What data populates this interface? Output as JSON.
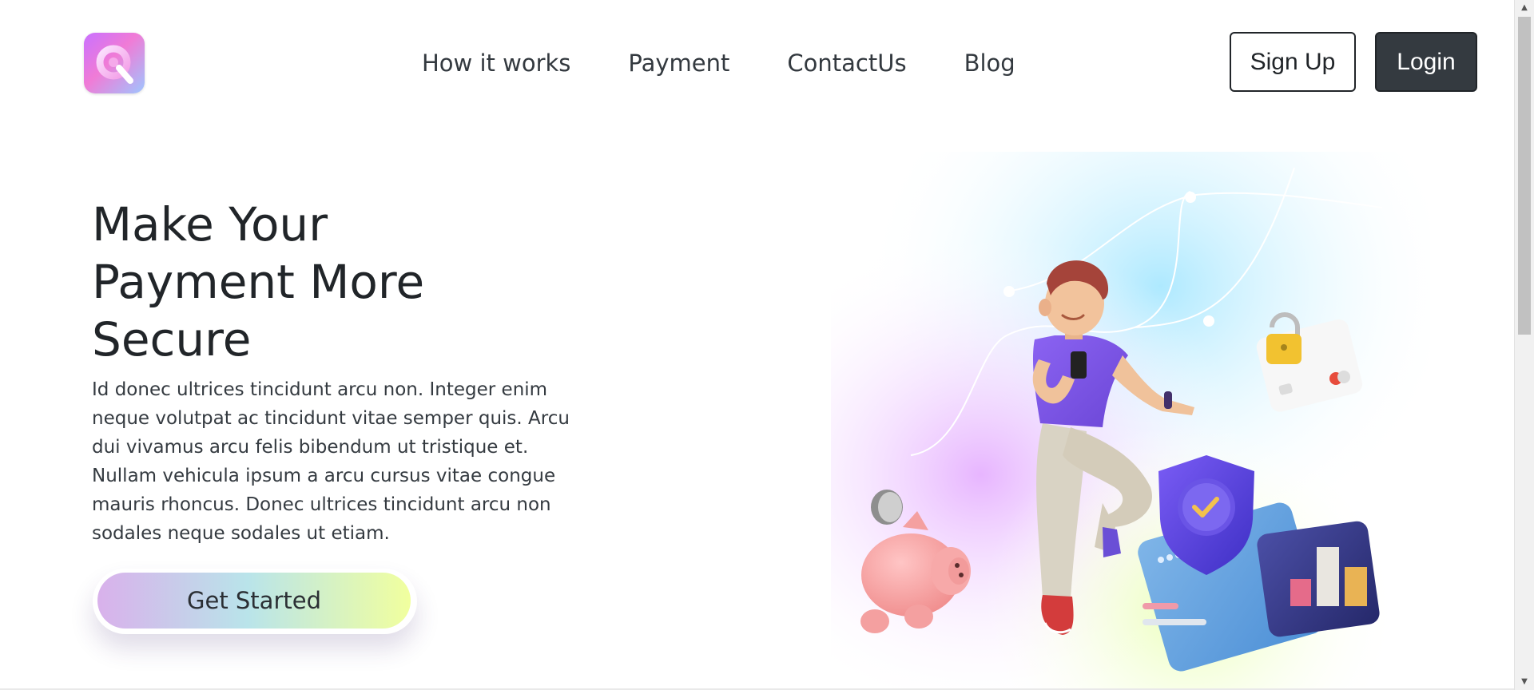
{
  "brand": {
    "logo_icon": "q-logo-icon",
    "accent": "#c971ff"
  },
  "nav": {
    "links": [
      {
        "label": "How it works"
      },
      {
        "label": "Payment"
      },
      {
        "label": "ContactUs"
      },
      {
        "label": "Blog"
      }
    ],
    "signup_label": "Sign Up",
    "login_label": "Login"
  },
  "hero": {
    "title": "Make Your Payment More Secure",
    "body": "Id donec ultrices tincidunt arcu non. Integer enim neque volutpat ac tincidunt vitae semper quis. Arcu dui vivamus arcu felis bibendum ut tristique et. Nullam vehicula ipsum a arcu cursus vitae congue mauris rhoncus. Donec ultrices tincidunt arcu non sodales neque sodales ut etiam.",
    "cta_label": "Get Started",
    "illustration_icon": "secure-payment-illustration"
  },
  "scrollbar": {
    "up_icon": "scroll-up-arrow-icon",
    "down_icon": "scroll-down-arrow-icon"
  },
  "colors": {
    "text": "#212529",
    "login_bg": "#343a40",
    "cta_gradient": [
      "#d9b1eb",
      "#b9e4ea",
      "#f1ff9e"
    ]
  }
}
